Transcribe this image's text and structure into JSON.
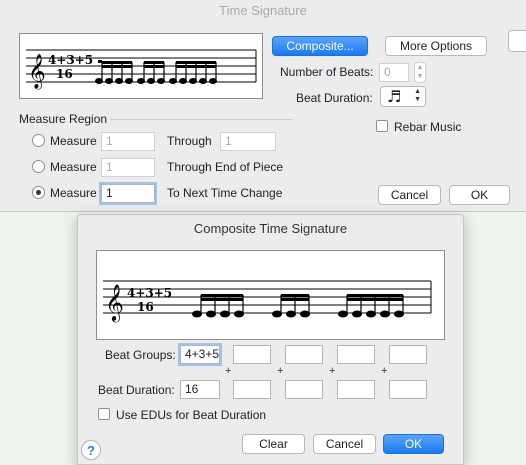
{
  "time_signature_window": {
    "title": "Time Signature",
    "timesig_label": "4+3+5 16",
    "composite_button": "Composite...",
    "more_options_button": "More Options",
    "number_of_beats_label": "Number of Beats:",
    "number_of_beats_value": "0",
    "beat_duration_label": "Beat Duration:",
    "beat_duration_icon": "sixteenth-note-icon",
    "rebar_music_label": "Rebar Music",
    "rebar_music_checked": false,
    "measure_region_label": "Measure Region",
    "rows": [
      {
        "label": "Measure",
        "from_value": "1",
        "suffix": "Through",
        "to_value": "1",
        "selected": false
      },
      {
        "label": "Measure",
        "from_value": "1",
        "suffix": "Through End of Piece",
        "selected": false
      },
      {
        "label": "Measure",
        "from_value": "1",
        "suffix": "To Next Time Change",
        "selected": true
      }
    ],
    "cancel_button": "Cancel",
    "ok_button": "OK"
  },
  "composite_window": {
    "title": "Composite Time Signature",
    "timesig_label": "4+3+5 16",
    "beat_groups_label": "Beat Groups:",
    "beat_groups_values": [
      "4+3+5",
      "",
      "",
      "",
      ""
    ],
    "plus_sign": "+",
    "beat_duration_label": "Beat Duration:",
    "beat_duration_values": [
      "16",
      "",
      "",
      "",
      ""
    ],
    "use_edus_label": "Use EDUs for Beat Duration",
    "use_edus_checked": false,
    "help_button": "?",
    "clear_button": "Clear",
    "cancel_button": "Cancel",
    "ok_button": "OK"
  },
  "colors": {
    "accent": "#1a79f4",
    "background": "#eef3ee"
  }
}
